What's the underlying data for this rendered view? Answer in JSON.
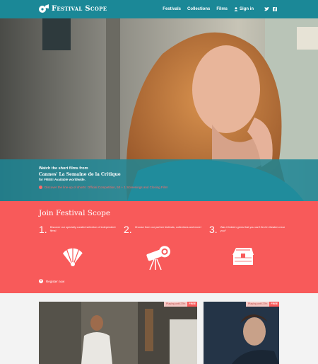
{
  "brand": {
    "name": "Festival Scope"
  },
  "nav": {
    "links": [
      "Festivals",
      "Collections",
      "Films"
    ],
    "signin": "Sign in",
    "social": [
      "twitter-icon",
      "facebook-icon"
    ]
  },
  "hero": {
    "line1": "Watch the short films from",
    "line2": "Cannes' La Semaine de la Critique",
    "line3": "for FREE! Available worldwide.",
    "line4": "Discover the line-up of shorts: Official Competition, 50 + 1 Screenings and Closing Film!",
    "slide_count": 3,
    "active_slide": 1
  },
  "join": {
    "title": "Join Festival Scope",
    "steps": [
      {
        "num": "1.",
        "text": "Discover our specially curated selection of independent films!"
      },
      {
        "num": "2.",
        "text": "Choose from our partner festivals, collections and more!"
      },
      {
        "num": "3.",
        "text": "Was it hidden gems that you can't find in theaters near you?"
      }
    ],
    "register": "Register now"
  },
  "cards": [
    {
      "badge": "Playing until 27th",
      "free": "FREE"
    },
    {
      "badge": "Playing until 27th",
      "free": "FREE"
    }
  ],
  "colors": {
    "nav": "#1b8897",
    "coral": "#f85a5a",
    "teal_band": "#1b8897"
  }
}
